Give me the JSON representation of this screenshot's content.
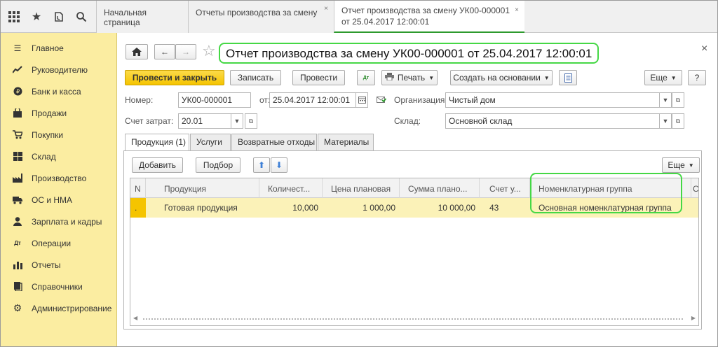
{
  "top_tabs": [
    {
      "label": "Начальная страница"
    },
    {
      "label": "Отчеты производства за смену",
      "close": "×"
    },
    {
      "label_line1": "Отчет производства за смену УК00-000001",
      "label_line2": "от 25.04.2017 12:00:01",
      "close": "×"
    }
  ],
  "sidebar": {
    "items": [
      {
        "label": "Главное",
        "icon": "menu-icon"
      },
      {
        "label": "Руководителю",
        "icon": "chart-line-icon"
      },
      {
        "label": "Банк и касса",
        "icon": "coin-icon"
      },
      {
        "label": "Продажи",
        "icon": "bag-icon"
      },
      {
        "label": "Покупки",
        "icon": "cart-icon"
      },
      {
        "label": "Склад",
        "icon": "warehouse-icon"
      },
      {
        "label": "Производство",
        "icon": "factory-icon"
      },
      {
        "label": "ОС и НМА",
        "icon": "truck-icon"
      },
      {
        "label": "Зарплата и кадры",
        "icon": "person-icon"
      },
      {
        "label": "Операции",
        "icon": "dt-kt-icon"
      },
      {
        "label": "Отчеты",
        "icon": "bar-chart-icon"
      },
      {
        "label": "Справочники",
        "icon": "books-icon"
      },
      {
        "label": "Администрирование",
        "icon": "gear-icon"
      }
    ]
  },
  "document": {
    "title": "Отчет производства за смену УК00-000001 от 25.04.2017 12:00:01",
    "close": "×"
  },
  "toolbar": {
    "post_close": "Провести и закрыть",
    "save": "Записать",
    "post": "Провести",
    "print": "Печать",
    "create_basis": "Создать на основании",
    "more": "Еще",
    "help": "?"
  },
  "form": {
    "number_label": "Номер:",
    "number_value": "УК00-000001",
    "from_label": "от:",
    "date_value": "25.04.2017 12:00:01",
    "org_label": "Организация:",
    "org_value": "Чистый дом",
    "account_label": "Счет затрат:",
    "account_value": "20.01",
    "warehouse_label": "Склад:",
    "warehouse_value": "Основной склад"
  },
  "subtabs": [
    {
      "label": "Продукция (1)"
    },
    {
      "label": "Услуги"
    },
    {
      "label": "Возвратные отходы"
    },
    {
      "label": "Материалы"
    }
  ],
  "grid_toolbar": {
    "add": "Добавить",
    "pick": "Подбор",
    "more": "Еще"
  },
  "table": {
    "columns": [
      "N",
      "Продукция",
      "Количест...",
      "Цена плановая",
      "Сумма плано...",
      "Счет у...",
      "Номенклатурная группа",
      "С"
    ],
    "rows": [
      {
        "n": ".",
        "product": "Готовая продукция",
        "qty": "10,000",
        "price": "1 000,00",
        "sum": "10 000,00",
        "account": "43",
        "group": "Основная номенклатурная группа"
      }
    ]
  },
  "colors": {
    "sidebar_bg": "#fbeda1",
    "primary_button": "#f5c400",
    "highlight": "#45d845",
    "selected_row": "#fbf2b8"
  }
}
